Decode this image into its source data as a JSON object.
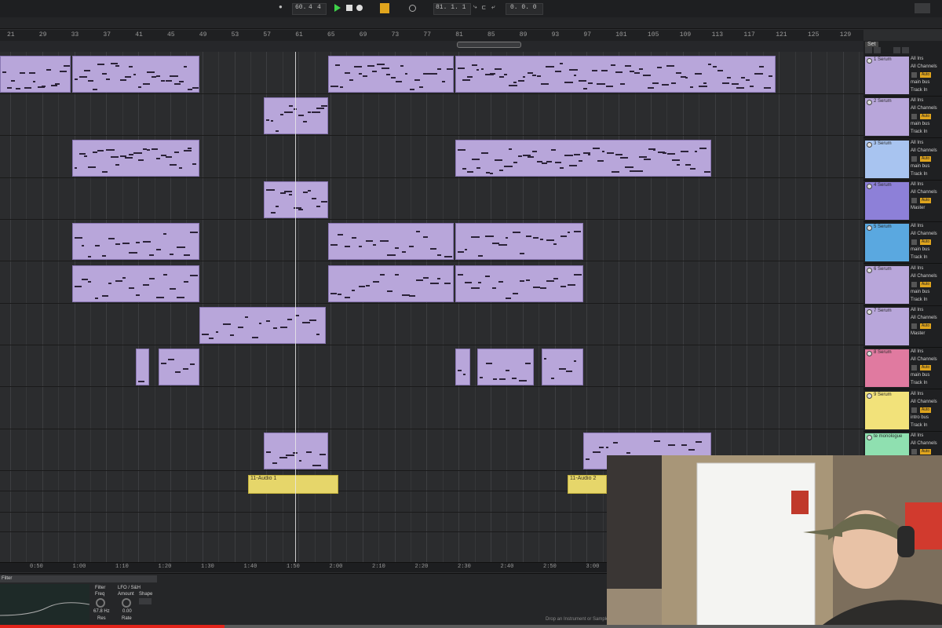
{
  "transport": {
    "tempo": "60.",
    "meter_num": "4",
    "meter_den": "4",
    "position": "81.  1.  1",
    "position_right": "0.  0.  0"
  },
  "ruler": {
    "bars": [
      "21",
      "29",
      "33",
      "37",
      "41",
      "45",
      "49",
      "53",
      "57",
      "61",
      "65",
      "69",
      "73",
      "77",
      "81",
      "85",
      "89",
      "93",
      "97",
      "101",
      "105",
      "109",
      "113",
      "117",
      "121",
      "125",
      "129"
    ]
  },
  "time_ruler": {
    "labels": [
      "0:50",
      "1:00",
      "1:10",
      "1:20",
      "1:30",
      "1:40",
      "1:50",
      "2:00",
      "2:10",
      "2:20",
      "2:30",
      "2:40",
      "2:50",
      "3:00"
    ]
  },
  "set_label": "Set",
  "tracks": [
    {
      "name": "1 Serum",
      "color": "#b8a6da",
      "input": "All Ins",
      "channel": "All Channels",
      "route": "main bus",
      "monitor": "Track In",
      "auto": "Auto"
    },
    {
      "name": "2 Serum",
      "color": "#b8a6da",
      "input": "All Ins",
      "channel": "All Channels",
      "route": "main bus",
      "monitor": "Track In",
      "auto": "Auto"
    },
    {
      "name": "3 Serum",
      "color": "#a8c4f0",
      "input": "All Ins",
      "channel": "All Channels",
      "route": "main bus",
      "monitor": "Track In",
      "auto": "Auto"
    },
    {
      "name": "4 Serum",
      "color": "#8d80d8",
      "input": "All Ins",
      "channel": "All Channels",
      "route": "Master",
      "monitor": "",
      "auto": "Auto"
    },
    {
      "name": "5 Serum",
      "color": "#5aa8e0",
      "input": "All Ins",
      "channel": "All Channels",
      "route": "main bus",
      "monitor": "Track In",
      "auto": "Auto"
    },
    {
      "name": "6 Serum",
      "color": "#b8a6da",
      "input": "All Ins",
      "channel": "All Channels",
      "route": "main bus",
      "monitor": "Track In",
      "auto": "Auto"
    },
    {
      "name": "7 Serum",
      "color": "#b8a6da",
      "input": "All Ins",
      "channel": "All Channels",
      "route": "Master",
      "monitor": "",
      "auto": "Auto"
    },
    {
      "name": "8 Serum",
      "color": "#e07aa0",
      "input": "All Ins",
      "channel": "All Channels",
      "route": "main bus",
      "monitor": "Track In",
      "auto": "Auto"
    },
    {
      "name": "9 Serum",
      "color": "#f2e27a",
      "input": "All Ins",
      "channel": "All Channels",
      "route": "intro bus",
      "monitor": "Track In",
      "auto": "Auto"
    },
    {
      "name": "te monologue",
      "color": "#8fe0b0",
      "input": "All Ins",
      "channel": "All Channels",
      "route": "",
      "monitor": "",
      "auto": "Auto"
    }
  ],
  "audio_clips": [
    {
      "name": "11-Audio 1"
    },
    {
      "name": "11-Audio 2"
    }
  ],
  "device": {
    "filter_label": "Filter",
    "freq_label": "Freq",
    "freq_value": "67.8 Hz",
    "res_label": "Res",
    "lfo_label": "LFO / S&H",
    "amount_label": "Amount",
    "amount_value": "0.00",
    "shape_label": "Shape",
    "rate_label": "Rate",
    "drop_hint": "Drop an Instrument or Sample Here"
  },
  "video_progress": 0.238
}
